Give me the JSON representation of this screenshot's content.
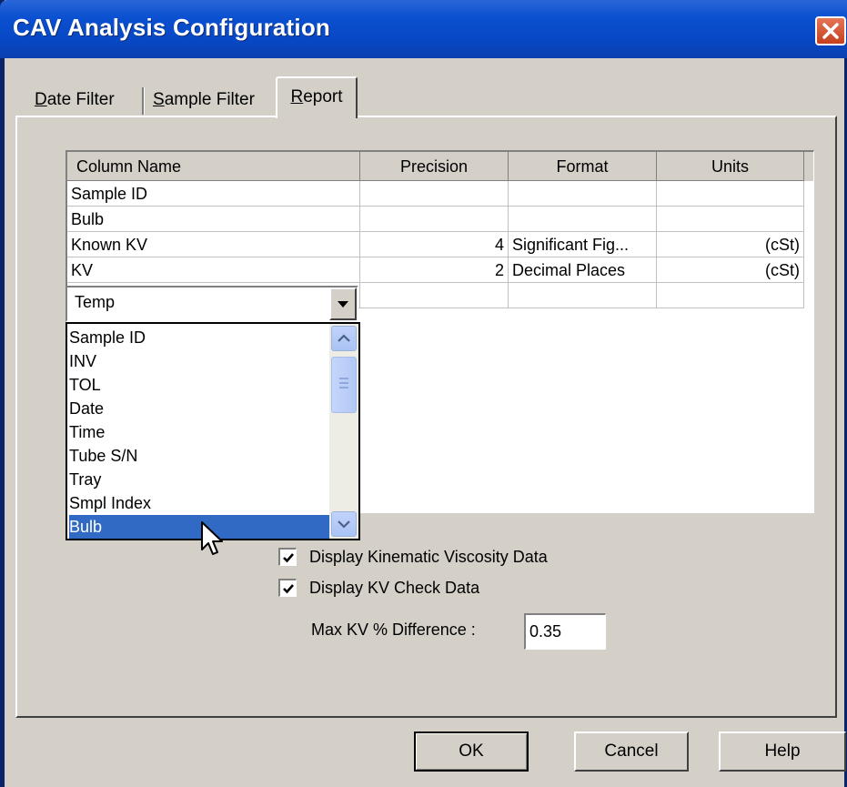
{
  "window": {
    "title": "CAV Analysis Configuration"
  },
  "tabs": [
    {
      "label": "Date Filter",
      "underline": "D",
      "rest": "ate Filter"
    },
    {
      "label": "Sample Filter",
      "underline": "S",
      "rest": "ample Filter"
    },
    {
      "label": "Report",
      "underline": "R",
      "rest": "eport",
      "active": true
    }
  ],
  "grid": {
    "headers": [
      "Column Name",
      "Precision",
      "Format",
      "Units"
    ],
    "rows": [
      {
        "name": "Sample ID",
        "precision": "",
        "format": "",
        "units": ""
      },
      {
        "name": "Bulb",
        "precision": "",
        "format": "",
        "units": ""
      },
      {
        "name": "Known KV",
        "precision": "4",
        "format": "Significant Fig...",
        "units": "(cSt)"
      },
      {
        "name": "KV",
        "precision": "2",
        "format": "Decimal Places",
        "units": "(cSt)"
      }
    ]
  },
  "combo": {
    "value": "Temp",
    "options": [
      "Sample ID",
      "INV",
      "TOL",
      "Date",
      "Time",
      "Tube S/N",
      "Tray",
      "Smpl Index",
      "Bulb"
    ],
    "highlighted": "Bulb"
  },
  "checks": {
    "kinematic": {
      "label": "Display Kinematic Viscosity Data",
      "checked": true
    },
    "kvcheck": {
      "label": "Display KV Check Data",
      "checked": true
    }
  },
  "maxkv": {
    "label": "Max KV % Difference :",
    "value": "0.35"
  },
  "buttons": {
    "ok": "OK",
    "cancel": "Cancel",
    "help": "Help"
  },
  "colors": {
    "titlebar": "#0a50d0",
    "selection": "#316ac5",
    "dialog": "#d4d0c8"
  }
}
